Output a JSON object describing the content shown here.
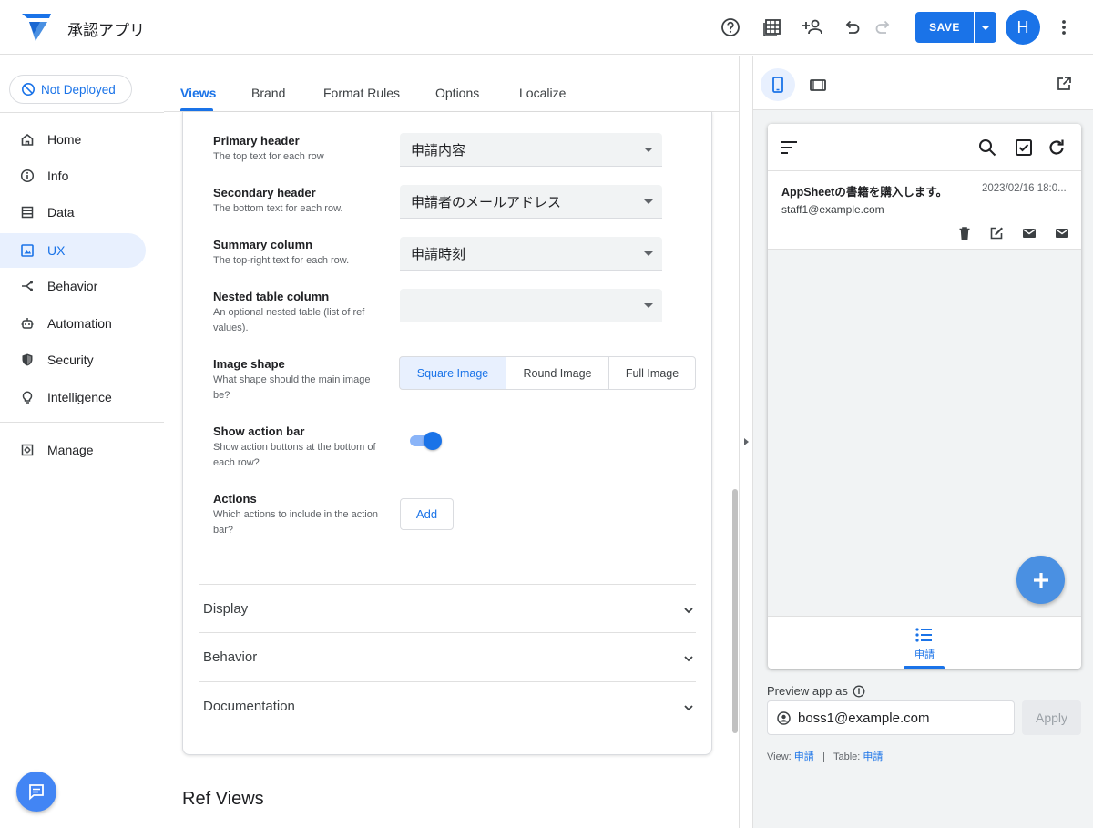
{
  "app": {
    "title": "承認アプリ"
  },
  "toolbar": {
    "save_label": "SAVE",
    "avatar_initial": "H",
    "icons": [
      "help-icon",
      "table-view-icon",
      "share-user-icon",
      "undo-icon",
      "redo-icon",
      "more-vert-icon"
    ]
  },
  "sidebar": {
    "deploy_status": "Not Deployed",
    "items": [
      {
        "label": "Home",
        "icon": "home-icon"
      },
      {
        "label": "Info",
        "icon": "info-icon"
      },
      {
        "label": "Data",
        "icon": "data-icon"
      },
      {
        "label": "UX",
        "icon": "ux-icon",
        "active": true
      },
      {
        "label": "Behavior",
        "icon": "behavior-icon"
      },
      {
        "label": "Automation",
        "icon": "automation-icon"
      },
      {
        "label": "Security",
        "icon": "security-icon"
      },
      {
        "label": "Intelligence",
        "icon": "intelligence-icon"
      }
    ],
    "manage_label": "Manage"
  },
  "tabs": [
    {
      "label": "Views",
      "active": true
    },
    {
      "label": "Brand"
    },
    {
      "label": "Format Rules"
    },
    {
      "label": "Options"
    },
    {
      "label": "Localize"
    }
  ],
  "form": {
    "primary_header": {
      "label": "Primary header",
      "desc": "The top text for each row",
      "value": "申請内容"
    },
    "secondary_header": {
      "label": "Secondary header",
      "desc": "The bottom text for each row.",
      "value": "申請者のメールアドレス"
    },
    "summary_column": {
      "label": "Summary column",
      "desc": "The top-right text for each row.",
      "value": "申請時刻"
    },
    "nested_table": {
      "label": "Nested table column",
      "desc": "An optional nested table (list of ref values).",
      "value": ""
    },
    "image_shape": {
      "label": "Image shape",
      "desc": "What shape should the main image be?",
      "options": [
        "Square Image",
        "Round Image",
        "Full Image"
      ],
      "selected": "Square Image"
    },
    "show_action_bar": {
      "label": "Show action bar",
      "desc": "Show action buttons at the bottom of each row?",
      "value": true
    },
    "actions": {
      "label": "Actions",
      "desc": "Which actions to include in the action bar?",
      "add_label": "Add"
    }
  },
  "accordions": [
    "Display",
    "Behavior",
    "Documentation"
  ],
  "ref_views_title": "Ref Views",
  "preview": {
    "row": {
      "title": "AppSheetの書籍を購入します。",
      "date": "2023/02/16 18:0...",
      "subtitle": "staff1@example.com"
    },
    "bottom_tab_label": "申請",
    "preview_as_label": "Preview app as",
    "preview_email": "boss1@example.com",
    "apply_label": "Apply",
    "view_prefix": "View:",
    "view_name": "申請",
    "table_prefix": "Table:",
    "table_name": "申請",
    "separator": "|"
  },
  "colors": {
    "accent": "#1a73e8",
    "active_bg": "#e8f0fe",
    "fab": "#4a90e2"
  }
}
